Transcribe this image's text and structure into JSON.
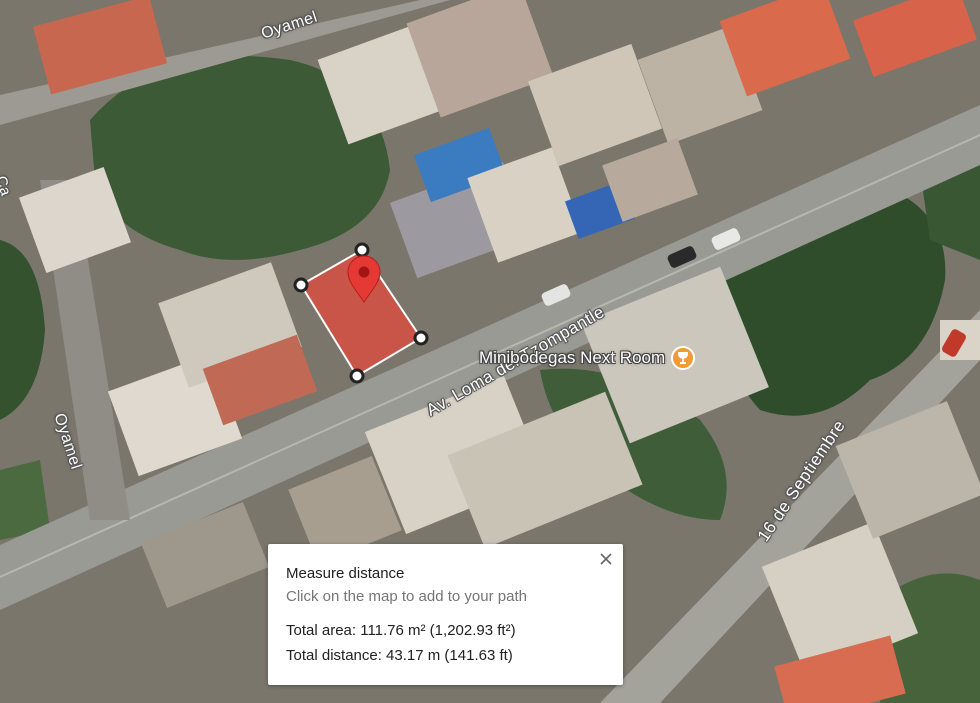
{
  "map": {
    "street_labels": {
      "oyamel_top": "Oyamel",
      "oyamel_left": "Oyamel",
      "av_loma": "Av. Loma del Tzompantle",
      "sixteen_sep": "16 de Septiembre",
      "edge": "Ca"
    },
    "poi": {
      "name": "Minibodegas Next Room",
      "icon": "wine-glass-icon",
      "color": "#f29a33"
    },
    "marker": {
      "icon": "location-pin-icon",
      "color": "#e53935"
    },
    "measure_polygon": {
      "fill": "#f44336",
      "vertices": 4
    }
  },
  "measure_panel": {
    "title": "Measure distance",
    "hint": "Click on the map to add to your path",
    "total_area": "Total area: 111.76 m² (1,202.93 ft²)",
    "total_distance": "Total distance: 43.17 m (141.63 ft)",
    "close_icon": "close-icon"
  }
}
